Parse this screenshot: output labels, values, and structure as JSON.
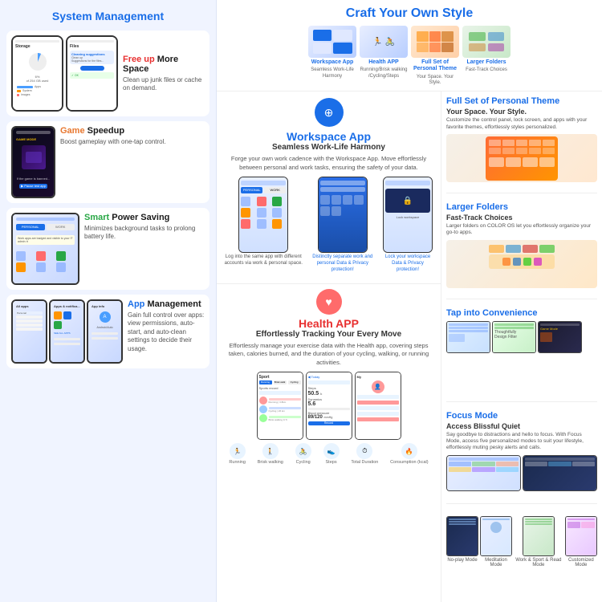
{
  "page": {
    "title": "System Management"
  },
  "left": {
    "header": "System Management",
    "sections": [
      {
        "id": "storage",
        "title": "Free up More Space",
        "title_plain": "Free up More Space",
        "highlight": "Free up",
        "desc": "Clean up junk files or cache on demand.",
        "highlight_color": "red"
      },
      {
        "id": "game",
        "title": "Game Speedup",
        "highlight": "Game",
        "desc": "Boost gameplay with one-tap control.",
        "highlight_color": "orange"
      },
      {
        "id": "power",
        "title": "Smart Power Saving",
        "highlight": "Smart",
        "desc": "Minimizes background tasks to prolong battery life.",
        "highlight_color": "green"
      },
      {
        "id": "apps",
        "title": "App Management",
        "highlight": "App",
        "desc": "Gain full control over apps: view permissions, auto-start, and auto-clean settings to decide their usage.",
        "highlight_color": "blue"
      }
    ]
  },
  "right": {
    "craft": {
      "title": "Craft Your Own Style",
      "items": [
        {
          "id": "workspace",
          "label": "Workspace App",
          "sublabel": "Seamless Work-Life Harmony"
        },
        {
          "id": "health",
          "label": "Health APP",
          "sublabel": "Running/Brisk walking /Cycling/Steps"
        },
        {
          "id": "personal",
          "label": "Full Set of Personal Theme",
          "sublabel": "Your Space. Your Style."
        },
        {
          "id": "folders",
          "label": "Larger Folders",
          "sublabel": "Fast-Track Choices"
        }
      ]
    },
    "workspace": {
      "icon": "⊕",
      "title": "Workspace App",
      "subtitle": "Seamless Work-Life Harmony",
      "desc": "Forge your own work cadence with the Workspace App. Move effortlessly between personal and work tasks, ensuring the safety of your data.",
      "captions": [
        "Log into the same app with different accounts via work & personal space.",
        "Distinctly separate work and personal Data & Privacy protection!",
        "Lock your workspace Data & Privacy protection!"
      ]
    },
    "health": {
      "icon": "♥",
      "title": "Health APP",
      "subtitle": "Effortlessly Tracking Your Every Move",
      "desc": "Effortlessly manage your exercise data with the Health app, covering steps taken, calories burned, and the duration of your cycling, walking, or running activities.",
      "activities": [
        "Running",
        "Brisk walking",
        "Cycling",
        "Steps",
        "Total Duration",
        "Consumption (kcal)"
      ]
    },
    "features": {
      "personal_theme": {
        "title": "Full Set of Personal Theme",
        "subtitle": "Your Space. Your Style.",
        "desc": "Customize the control panel, lock screen, and apps with your favorite themes, effortlessly styles personalized."
      },
      "larger_folders": {
        "title": "Larger Folders",
        "subtitle": "Fast-Track Choices",
        "desc": "Larger folders on COLOR OS let you effortlessly organize your go-to apps."
      },
      "tap_convenience": {
        "title": "Tap into Convenience",
        "subtitle": "",
        "desc": ""
      },
      "focus_mode": {
        "title": "Focus Mode",
        "subtitle": "Access Blissful Quiet",
        "desc": "Say goodbye to distractions and hello to focus. With Focus Mode, access five personalized modes to suit your lifestyle, effortlessly muting pesky alerts and calls."
      },
      "modes": {
        "items": [
          "No-play Mode",
          "Meditation Mode",
          "Work & Sport & Read Mode",
          "Customized Mode"
        ]
      }
    }
  }
}
